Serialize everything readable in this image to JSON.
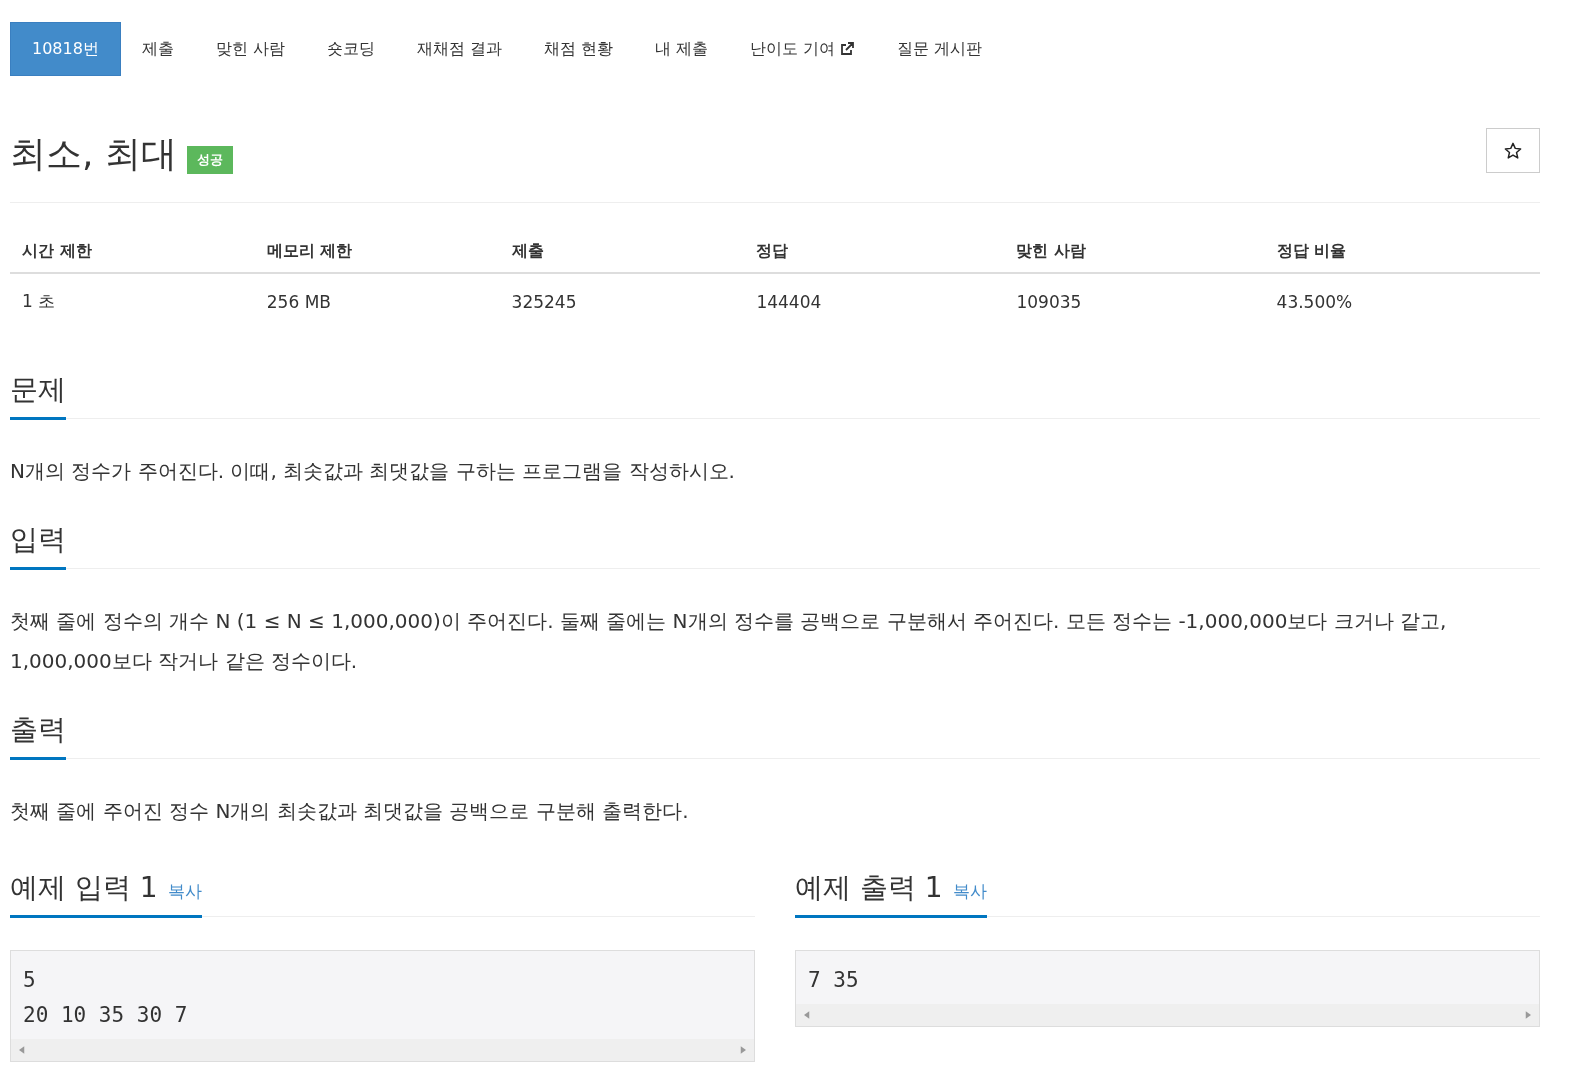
{
  "tabs": [
    {
      "label": "10818번",
      "selected": true,
      "kind": "plain"
    },
    {
      "label": "제출",
      "selected": false,
      "kind": "plain"
    },
    {
      "label": "맞힌 사람",
      "selected": false,
      "kind": "plain"
    },
    {
      "label": "숏코딩",
      "selected": false,
      "kind": "plain"
    },
    {
      "label": "재채점 결과",
      "selected": false,
      "kind": "plain"
    },
    {
      "label": "채점 현황",
      "selected": false,
      "kind": "plain"
    },
    {
      "label": "내 제출",
      "selected": false,
      "kind": "plain"
    },
    {
      "label": "난이도 기여",
      "selected": false,
      "kind": "external"
    },
    {
      "label": "질문 게시판",
      "selected": false,
      "kind": "plain"
    }
  ],
  "title": "최소, 최대",
  "status_badge": {
    "label": "성공",
    "color": "#5cb85c"
  },
  "info_table": {
    "columns": [
      "시간 제한",
      "메모리 제한",
      "제출",
      "정답",
      "맞힌 사람",
      "정답 비율"
    ],
    "rows": [
      [
        "1 초",
        "256 MB",
        "325245",
        "144404",
        "109035",
        "43.500%"
      ]
    ]
  },
  "sections": [
    {
      "heading": "문제",
      "paragraphs": [
        "N개의 정수가 주어진다. 이때, 최솟값과 최댓값을 구하는 프로그램을 작성하시오."
      ]
    },
    {
      "heading": "입력",
      "paragraphs": [
        "첫째 줄에 정수의 개수 N (1 ≤ N ≤ 1,000,000)이 주어진다. 둘째 줄에는 N개의 정수를 공백으로 구분해서 주어진다. 모든 정수는 -1,000,000보다 크거나 같고, 1,000,000보다 작거나 같은 정수이다."
      ]
    },
    {
      "heading": "출력",
      "paragraphs": [
        "첫째 줄에 주어진 정수 N개의 최솟값과 최댓값을 공백으로 구분해 출력한다."
      ]
    }
  ],
  "samples": [
    {
      "heading": "예제 입력 1",
      "copy": "복사",
      "lines": [
        "5",
        "20 10 35 30 7"
      ]
    },
    {
      "heading": "예제 출력 1",
      "copy": "복사",
      "lines": [
        "7 35"
      ]
    }
  ]
}
